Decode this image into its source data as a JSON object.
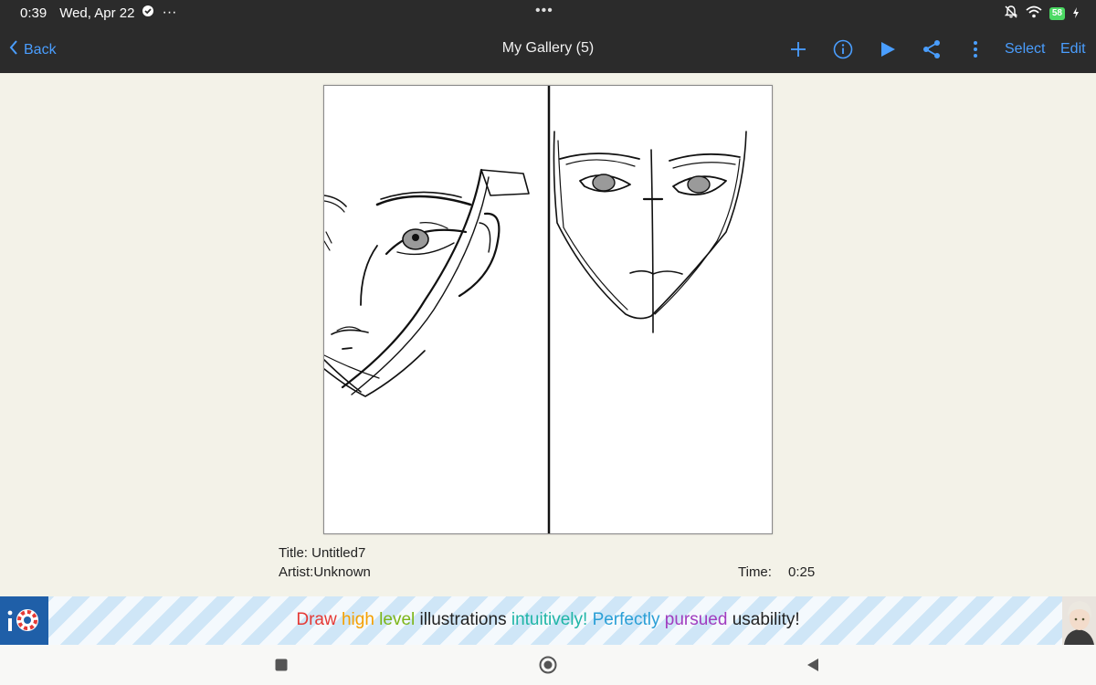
{
  "status_bar": {
    "time": "0:39",
    "date": "Wed, Apr 22",
    "more_dots": "···",
    "center_handle": "•••",
    "battery": "58"
  },
  "nav": {
    "back_label": "Back",
    "title": "My Gallery (5)",
    "select_label": "Select",
    "edit_label": "Edit"
  },
  "artwork": {
    "title_label": "Title: Untitled7",
    "artist_label": "Artist:Unknown",
    "time_label": "Time:",
    "time_value": "0:25"
  },
  "ad": {
    "segments": [
      {
        "text": "Draw ",
        "color": "#e53935"
      },
      {
        "text": "high ",
        "color": "#f5a000"
      },
      {
        "text": "level ",
        "color": "#7cb518"
      },
      {
        "text": "illustrations ",
        "color": "#222222"
      },
      {
        "text": "intuitively! ",
        "color": "#1fb5a6"
      },
      {
        "text": "Perfectly ",
        "color": "#2a9fd6"
      },
      {
        "text": "pursued ",
        "color": "#a03cbf"
      },
      {
        "text": "usability!",
        "color": "#222222"
      }
    ]
  },
  "colors": {
    "accent": "#4a9eff",
    "nav_bg": "#2b2b2b",
    "page_bg": "#f3f2e8"
  }
}
